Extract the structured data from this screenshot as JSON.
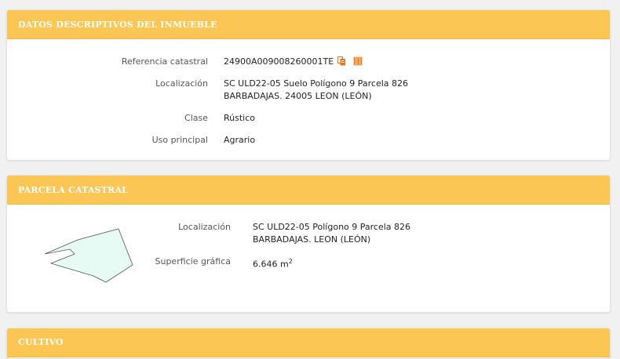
{
  "descriptivos": {
    "header": "DATOS DESCRIPTIVOS DEL INMUEBLE",
    "ref_label": "Referencia catastral",
    "ref_value": "24900A009008260001TE",
    "loc_label": "Localización",
    "loc_line1": "SC ULD22-05 Suelo Polígono 9 Parcela 826",
    "loc_line2": "BARBADAJAS. 24005 LEON (LEÓN)",
    "clase_label": "Clase",
    "clase_value": "Rústico",
    "uso_label": "Uso principal",
    "uso_value": "Agrario",
    "icons": [
      "copy-document-icon",
      "barcode-icon"
    ],
    "icon_color": "#e8731c"
  },
  "parcela": {
    "header": "PARCELA CATASTRAL",
    "loc_label": "Localización",
    "loc_line1": "SC ULD22-05 Polígono 9 Parcela 826",
    "loc_line2": "BARBADAJAS. LEON (LEÓN)",
    "sup_label": "Superficie gráfica",
    "sup_value": "6.646 m",
    "sup_unit_exp": "2",
    "shape_fill": "#e6fbf4",
    "shape_stroke": "#555555"
  },
  "cultivo": {
    "header": "CULTIVO"
  },
  "colors": {
    "header_bg": "#fbc653",
    "header_text": "#ffffff",
    "page_bg": "#f1f1f1"
  }
}
